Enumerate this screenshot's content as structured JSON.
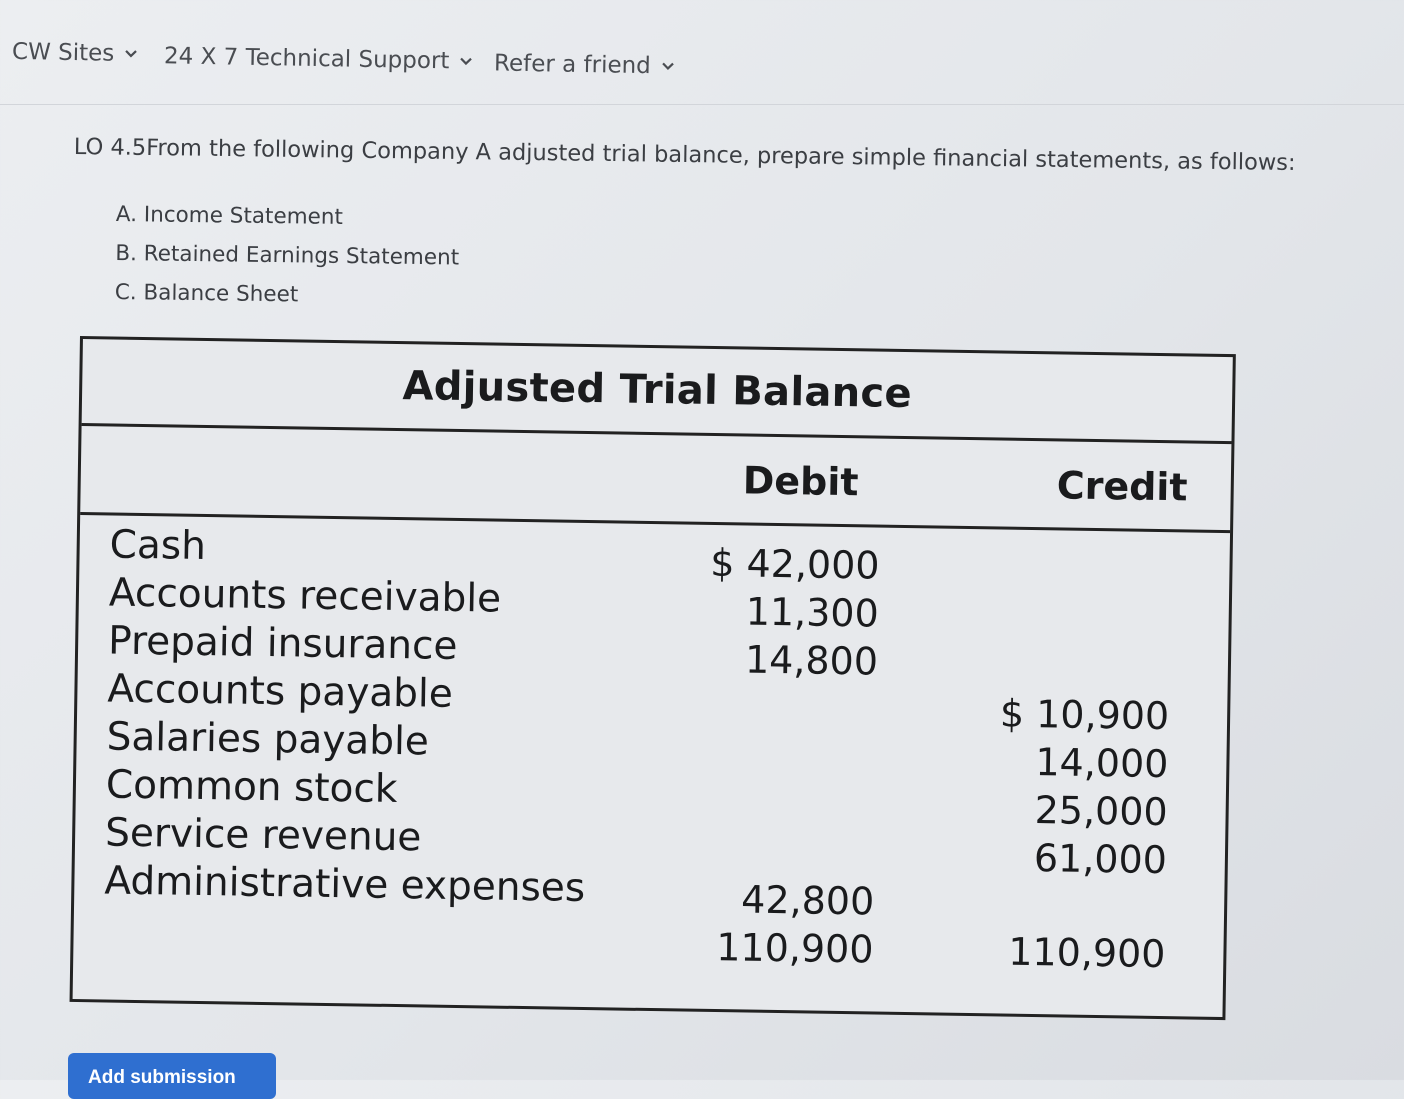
{
  "nav": {
    "items": [
      {
        "label": "CW Sites"
      },
      {
        "label": "24 X 7 Technical Support"
      },
      {
        "label": "Refer a friend"
      }
    ]
  },
  "question": {
    "text": "LO 4.5From the following Company A adjusted trial balance, prepare simple financial statements, as follows:",
    "parts": [
      "A. Income Statement",
      "B. Retained Earnings Statement",
      "C. Balance Sheet"
    ]
  },
  "trial_balance": {
    "title": "Adjusted Trial Balance",
    "headers": {
      "debit": "Debit",
      "credit": "Credit"
    },
    "accounts": [
      {
        "name": "Cash",
        "debit": "$ 42,000",
        "credit": ""
      },
      {
        "name": "Accounts receivable",
        "debit": "11,300",
        "credit": ""
      },
      {
        "name": "Prepaid insurance",
        "debit": "14,800",
        "credit": ""
      },
      {
        "name": "Accounts payable",
        "debit": "",
        "credit": "$ 10,900"
      },
      {
        "name": "Salaries payable",
        "debit": "",
        "credit": "14,000"
      },
      {
        "name": "Common stock",
        "debit": "",
        "credit": "25,000"
      },
      {
        "name": "Service revenue",
        "debit": "",
        "credit": "61,000"
      },
      {
        "name": "Administrative expenses",
        "debit": "42,800",
        "credit": ""
      }
    ],
    "totals": {
      "debit": "110,900",
      "credit": "110,900"
    }
  },
  "actions": {
    "add_submission": "Add submission"
  },
  "colors": {
    "button": "#2f6fd0",
    "table_border": "#222222"
  }
}
